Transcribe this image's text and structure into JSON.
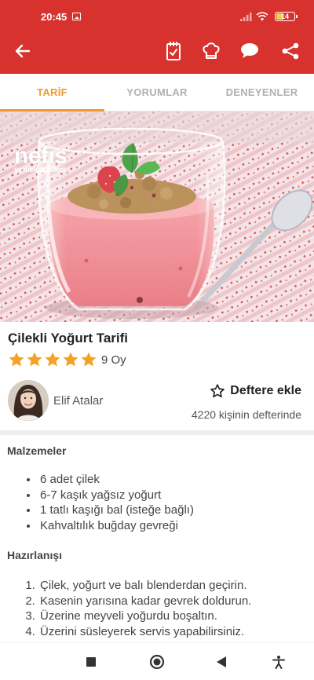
{
  "status_bar": {
    "time": "20:45",
    "battery_level": "14",
    "battery_fraction": 0.14,
    "battery_fill_color": "#f2d04a"
  },
  "app_bar": {
    "background_color": "#d8322f",
    "icons": [
      "back-arrow-icon",
      "notebook-check-icon",
      "chef-hat-icon",
      "comment-icon",
      "share-icon"
    ]
  },
  "tabs": [
    {
      "label": "TARİF",
      "active": true
    },
    {
      "label": "YORUMLAR",
      "active": false
    },
    {
      "label": "DENEYENLER",
      "active": false
    }
  ],
  "accent_color": "#f0992e",
  "hero": {
    "logo_main": "nefis",
    "logo_sub": "yemek tarifleri"
  },
  "recipe": {
    "title": "Çilekli Yoğurt Tarifi",
    "star_count": 5,
    "rating_text": "9 Oy",
    "star_color": "#f3a323"
  },
  "author": {
    "name": "Elif Atalar"
  },
  "favorites": {
    "label": "Deftere ekle",
    "count_text": "4220 kişinin defterinde"
  },
  "ingredients": {
    "heading": "Malzemeler",
    "items": [
      "6 adet çilek",
      "6-7 kaşık yağsız yoğurt",
      "1 tatlı kaşığı bal (isteğe bağlı)",
      "Kahvaltılık buğday gevreği"
    ]
  },
  "preparation": {
    "heading": "Hazırlanışı",
    "steps": [
      "Çilek, yoğurt ve balı blenderdan geçirin.",
      "Kasenin yarısına kadar gevrek doldurun.",
      "Üzerine meyveli yoğurdu boşaltın.",
      "Üzerini süsleyerek servis yapabilirsiniz."
    ]
  },
  "nav_bar": {
    "icons": [
      "square-recents-icon",
      "circle-home-icon",
      "triangle-back-icon",
      "accessibility-icon"
    ]
  }
}
